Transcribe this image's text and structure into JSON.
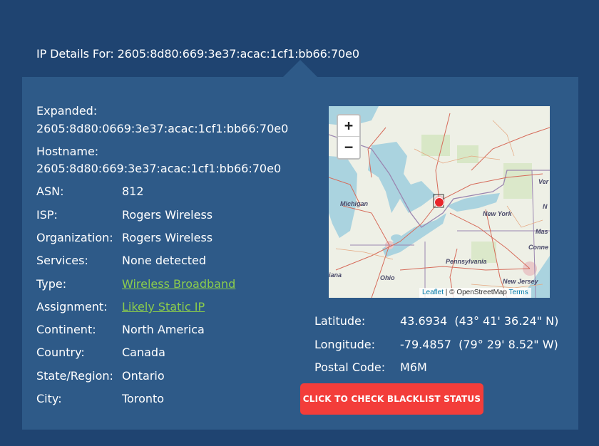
{
  "header": {
    "title": "IP Details For: 2605:8d80:669:3e37:acac:1cf1:bb66:70e0"
  },
  "details": {
    "expanded_label": "Expanded:",
    "expanded_value": "2605:8d80:0669:3e37:acac:1cf1:bb66:70e0",
    "hostname_label": "Hostname:",
    "hostname_value": "2605:8d80:669:3e37:acac:1cf1:bb66:70e0",
    "asn_label": "ASN:",
    "asn_value": "812",
    "isp_label": "ISP:",
    "isp_value": "Rogers Wireless",
    "org_label": "Organization:",
    "org_value": "Rogers Wireless",
    "services_label": "Services:",
    "services_value": "None detected",
    "type_label": "Type:",
    "type_value": "Wireless Broadband",
    "assignment_label": "Assignment:",
    "assignment_value": "Likely Static IP",
    "continent_label": "Continent:",
    "continent_value": "North America",
    "country_label": "Country:",
    "country_value": "Canada",
    "state_label": "State/Region:",
    "state_value": "Ontario",
    "city_label": "City:",
    "city_value": "Toronto"
  },
  "geo": {
    "latitude_label": "Latitude:",
    "latitude_value": "43.6934  (43° 41' 36.24\" N)",
    "longitude_label": "Longitude:",
    "longitude_value": "-79.4857  (79° 29' 8.52\" W)",
    "postal_label": "Postal Code:",
    "postal_value": "M6M"
  },
  "map": {
    "zoom_in": "+",
    "zoom_out": "−",
    "attribution_leaflet": "Leaflet",
    "attribution_sep": " | © OpenStreetMap ",
    "attribution_terms": "Terms",
    "labels": {
      "michigan": "Michigan",
      "new_york": "New York",
      "pennsylvania": "Pennsylvania",
      "ohio": "Ohio",
      "new_jersey": "New Jersey",
      "indiana": "iana",
      "ver": "Ver",
      "n": "N",
      "mas": "Mas",
      "conne": "Conne"
    }
  },
  "actions": {
    "blacklist_button": "CLICK TO CHECK BLACKLIST STATUS"
  },
  "colors": {
    "background": "#1f4471",
    "panel": "#2e5a88",
    "link": "#8ccd4b",
    "button": "#f33d3a"
  }
}
